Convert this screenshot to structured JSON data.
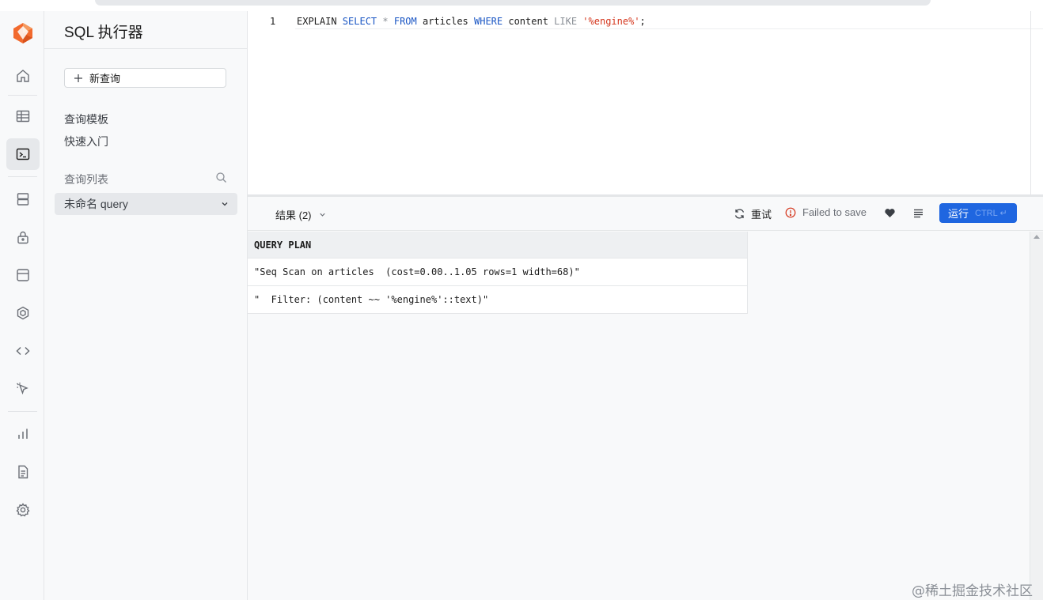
{
  "colors": {
    "accent": "#1f66e0",
    "brand": "#f26a2e",
    "error": "#d4351c",
    "keyword": "#1a56c4"
  },
  "rail": {
    "items": [
      {
        "name": "home",
        "icon": "home-icon"
      },
      {
        "name": "table-editor",
        "icon": "table-icon"
      },
      {
        "name": "sql-editor",
        "icon": "terminal-icon",
        "active": true
      },
      {
        "name": "database",
        "icon": "database-icon"
      },
      {
        "name": "auth",
        "icon": "lock-icon"
      },
      {
        "name": "storage",
        "icon": "storage-icon"
      },
      {
        "name": "edge-functions",
        "icon": "cube-icon"
      },
      {
        "name": "api",
        "icon": "code-icon"
      },
      {
        "name": "realtime",
        "icon": "pointer-icon"
      },
      {
        "name": "reports",
        "icon": "bar-chart-icon"
      },
      {
        "name": "logs",
        "icon": "document-icon"
      },
      {
        "name": "settings",
        "icon": "gear-icon"
      }
    ]
  },
  "panel": {
    "title": "SQL 执行器",
    "new_query": "新查询",
    "links": [
      "查询模板",
      "快速入门"
    ],
    "list_header": "查询列表",
    "queries": [
      "未命名 query"
    ]
  },
  "editor": {
    "line_number": "1",
    "tokens": [
      {
        "text": "EXPLAIN ",
        "cls": "k-plain"
      },
      {
        "text": "SELECT",
        "cls": "k-blue"
      },
      {
        "text": " * ",
        "cls": "k-gray"
      },
      {
        "text": "FROM",
        "cls": "k-blue"
      },
      {
        "text": " articles ",
        "cls": "k-plain"
      },
      {
        "text": "WHERE",
        "cls": "k-blue"
      },
      {
        "text": " content ",
        "cls": "k-plain"
      },
      {
        "text": "LIKE",
        "cls": "k-gray"
      },
      {
        "text": " ",
        "cls": "k-plain"
      },
      {
        "text": "'%engine%'",
        "cls": "k-red"
      },
      {
        "text": ";",
        "cls": "k-plain"
      }
    ]
  },
  "toolbar": {
    "results_label": "结果 (2)",
    "retry_label": "重试",
    "save_status": "Failed to save",
    "run_label": "运行",
    "run_shortcut": "CTRL ↵"
  },
  "results": {
    "column": "QUERY PLAN",
    "rows": [
      "\"Seq Scan on articles  (cost=0.00..1.05 rows=1 width=68)\"",
      "\"  Filter: (content ~~ '%engine%'::text)\""
    ]
  },
  "watermark": "@稀土掘金技术社区"
}
